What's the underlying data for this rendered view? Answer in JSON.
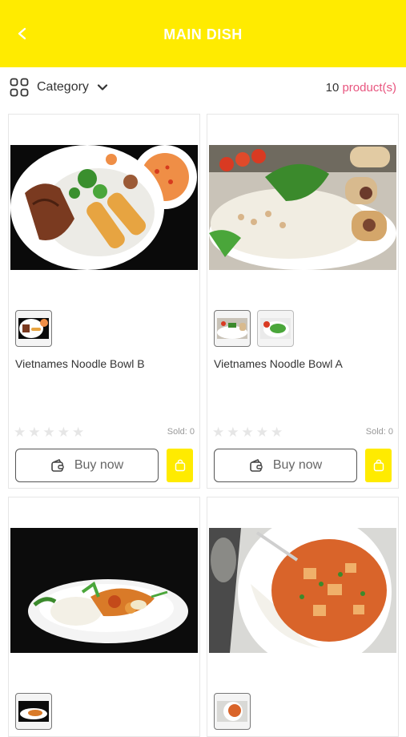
{
  "header": {
    "title": "MAIN DISH",
    "back_icon": "chevron-left-icon"
  },
  "toolbar": {
    "category_label": "Category",
    "count_number": "10",
    "count_unit": "product(s)",
    "grid_icon": "grid-icon",
    "dropdown_icon": "chevron-down-icon"
  },
  "colors": {
    "brand": "#FFEB00",
    "accent": "#e8557f"
  },
  "products": [
    {
      "name": "Vietnames Noodle Bowl B",
      "image": "noodle-bowl-b-photo",
      "thumbnails": [
        "noodle-bowl-b-thumb"
      ],
      "rating": 0,
      "sold": "Sold: 0",
      "buy_label": "Buy now"
    },
    {
      "name": "Vietnames Noodle Bowl A",
      "image": "noodle-bowl-a-photo",
      "thumbnails": [
        "noodle-bowl-a-thumb",
        "noodle-bowl-a-thumb-2"
      ],
      "rating": 0,
      "sold": "Sold: 0",
      "buy_label": "Buy now"
    },
    {
      "image": "stir-fry-rice-photo",
      "thumbnails": [
        "stir-fry-rice-thumb"
      ]
    },
    {
      "image": "curry-rice-photo",
      "thumbnails": [
        "curry-rice-thumb"
      ]
    }
  ]
}
